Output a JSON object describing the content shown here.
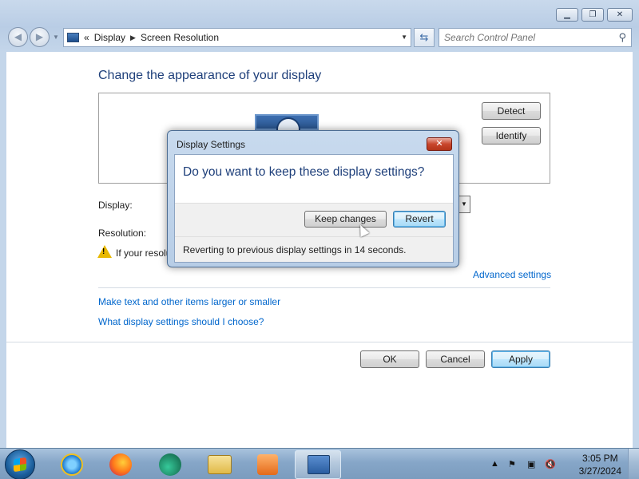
{
  "window": {
    "minimize_glyph": "▁",
    "maximize_glyph": "❐",
    "close_glyph": "✕"
  },
  "nav": {
    "back_glyph": "◀",
    "forward_glyph": "▶",
    "history_glyph": "▼",
    "breadcrumb_overflow": "«",
    "breadcrumb": [
      "Display",
      "Screen Resolution"
    ],
    "breadcrumb_sep": "▶",
    "address_dropdown_glyph": "▼",
    "refresh_glyph": "⇆",
    "search_placeholder": "Search Control Panel",
    "search_glyph": "⚲"
  },
  "main": {
    "title": "Change the appearance of your display",
    "detect_label": "Detect",
    "identify_label": "Identify",
    "display_label": "Display:",
    "resolution_label": "Resolution:",
    "warning_text": "If your resolu",
    "advanced_link": "Advanced settings",
    "link_larger_smaller": "Make text and other items larger or smaller",
    "link_which_settings": "What display settings should I choose?",
    "ok_label": "OK",
    "cancel_label": "Cancel",
    "apply_label": "Apply"
  },
  "dialog": {
    "title": "Display Settings",
    "close_glyph": "✕",
    "question": "Do you want to keep these display settings?",
    "keep_label": "Keep changes",
    "revert_label": "Revert",
    "status": "Reverting to previous display settings in 14 seconds."
  },
  "taskbar": {
    "pinned": [
      "internet-explorer",
      "firefox",
      "edge",
      "windows-explorer",
      "media-player"
    ],
    "active": "display-settings",
    "clock_time": "3:05 PM",
    "clock_date": "3/27/2024",
    "tray_up_glyph": "▲",
    "tray_flag_glyph": "⚑",
    "tray_network_glyph": "▣",
    "tray_volume_glyph": "🔇"
  },
  "colors": {
    "link": "#0066cc",
    "heading": "#1e3f7a",
    "dialog_frame": "#b7cde6"
  }
}
